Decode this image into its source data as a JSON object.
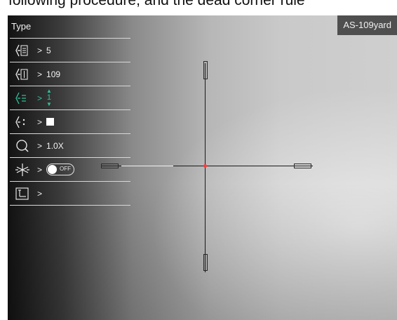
{
  "caption": "following procedure, and the dead corner rule",
  "badge": "AS-109yard",
  "menu": {
    "title": "Type",
    "items": [
      {
        "name": "menu-item-distance-type",
        "icon": "zero-distance-icon",
        "value": "5",
        "active": false
      },
      {
        "name": "menu-item-zero-distance",
        "icon": "distance-icon",
        "value": "109",
        "active": false
      },
      {
        "name": "menu-item-zero-row",
        "icon": "adjust-row-icon",
        "value": "1",
        "active": true
      },
      {
        "name": "menu-item-reticle-style",
        "icon": "reticle-style-icon",
        "value": "",
        "active": false
      },
      {
        "name": "menu-item-zoom",
        "icon": "zoom-icon",
        "value": "1.0X",
        "active": false
      },
      {
        "name": "menu-item-freeze",
        "icon": "freeze-icon",
        "value": "OFF",
        "active": false
      },
      {
        "name": "menu-item-position",
        "icon": "position-icon",
        "value": "",
        "active": false
      }
    ],
    "arrow": ">"
  }
}
